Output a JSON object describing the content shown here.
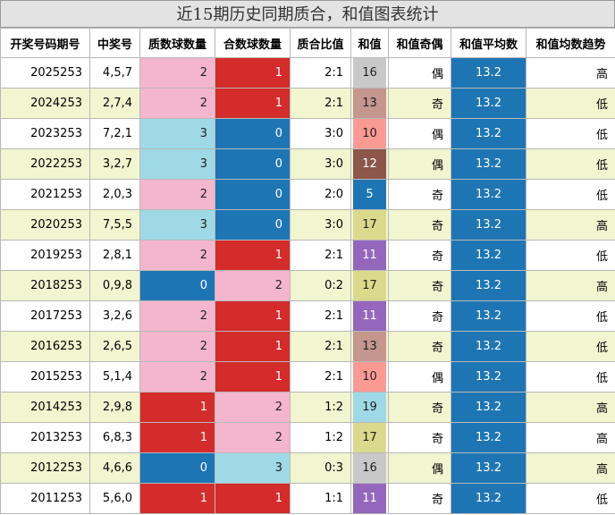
{
  "title": "近15期历史同期质合，和值图表统计",
  "headers": [
    "开奖号码期号",
    "中奖号",
    "质数球数量",
    "合数球数量",
    "质合比值",
    "和值",
    "和值奇偶",
    "和值平均数",
    "和值均数趋势"
  ],
  "colors": {
    "pink": "#f4b6cc",
    "red": "#d42b2b",
    "blue": "#1e75b4",
    "cyan": "#9fd9e6",
    "sum_gray": "#c8c8c8",
    "sum_rose": "#c4968e",
    "sum_salmon": "#fb9a92",
    "sum_brown": "#8c564b",
    "sum_blue": "#1e75b4",
    "sum_olive": "#dada8c",
    "sum_purple": "#9467bd",
    "sum_lightblue": "#9fd9e6",
    "row_alt": "#f1f5d0"
  },
  "rows": [
    {
      "issue": "2025253",
      "nums": "4,5,7",
      "prime": "2",
      "prime_c": "pink",
      "comp": "1",
      "comp_c": "red",
      "ratio": "2:1",
      "sum": "16",
      "sum_c": "sum_gray",
      "parity": "偶",
      "avg": "13.2",
      "trend": "高"
    },
    {
      "issue": "2024253",
      "nums": "2,7,4",
      "prime": "2",
      "prime_c": "pink",
      "comp": "1",
      "comp_c": "red",
      "ratio": "2:1",
      "sum": "13",
      "sum_c": "sum_rose",
      "parity": "奇",
      "avg": "13.2",
      "trend": "低"
    },
    {
      "issue": "2023253",
      "nums": "7,2,1",
      "prime": "3",
      "prime_c": "cyan",
      "comp": "0",
      "comp_c": "blue",
      "ratio": "3:0",
      "sum": "10",
      "sum_c": "sum_salmon",
      "parity": "偶",
      "avg": "13.2",
      "trend": "低"
    },
    {
      "issue": "2022253",
      "nums": "3,2,7",
      "prime": "3",
      "prime_c": "cyan",
      "comp": "0",
      "comp_c": "blue",
      "ratio": "3:0",
      "sum": "12",
      "sum_c": "sum_brown",
      "parity": "偶",
      "avg": "13.2",
      "trend": "低"
    },
    {
      "issue": "2021253",
      "nums": "2,0,3",
      "prime": "2",
      "prime_c": "pink",
      "comp": "0",
      "comp_c": "blue",
      "ratio": "2:0",
      "sum": "5",
      "sum_c": "sum_blue",
      "parity": "奇",
      "avg": "13.2",
      "trend": "低"
    },
    {
      "issue": "2020253",
      "nums": "7,5,5",
      "prime": "3",
      "prime_c": "cyan",
      "comp": "0",
      "comp_c": "blue",
      "ratio": "3:0",
      "sum": "17",
      "sum_c": "sum_olive",
      "parity": "奇",
      "avg": "13.2",
      "trend": "高"
    },
    {
      "issue": "2019253",
      "nums": "2,8,1",
      "prime": "2",
      "prime_c": "pink",
      "comp": "1",
      "comp_c": "red",
      "ratio": "2:1",
      "sum": "11",
      "sum_c": "sum_purple",
      "parity": "奇",
      "avg": "13.2",
      "trend": "低"
    },
    {
      "issue": "2018253",
      "nums": "0,9,8",
      "prime": "0",
      "prime_c": "blue",
      "comp": "2",
      "comp_c": "pink",
      "ratio": "0:2",
      "sum": "17",
      "sum_c": "sum_olive",
      "parity": "奇",
      "avg": "13.2",
      "trend": "高"
    },
    {
      "issue": "2017253",
      "nums": "3,2,6",
      "prime": "2",
      "prime_c": "pink",
      "comp": "1",
      "comp_c": "red",
      "ratio": "2:1",
      "sum": "11",
      "sum_c": "sum_purple",
      "parity": "奇",
      "avg": "13.2",
      "trend": "低"
    },
    {
      "issue": "2016253",
      "nums": "2,6,5",
      "prime": "2",
      "prime_c": "pink",
      "comp": "1",
      "comp_c": "red",
      "ratio": "2:1",
      "sum": "13",
      "sum_c": "sum_rose",
      "parity": "奇",
      "avg": "13.2",
      "trend": "低"
    },
    {
      "issue": "2015253",
      "nums": "5,1,4",
      "prime": "2",
      "prime_c": "pink",
      "comp": "1",
      "comp_c": "red",
      "ratio": "2:1",
      "sum": "10",
      "sum_c": "sum_salmon",
      "parity": "偶",
      "avg": "13.2",
      "trend": "低"
    },
    {
      "issue": "2014253",
      "nums": "2,9,8",
      "prime": "1",
      "prime_c": "red",
      "comp": "2",
      "comp_c": "pink",
      "ratio": "1:2",
      "sum": "19",
      "sum_c": "sum_lightblue",
      "parity": "奇",
      "avg": "13.2",
      "trend": "高"
    },
    {
      "issue": "2013253",
      "nums": "6,8,3",
      "prime": "1",
      "prime_c": "red",
      "comp": "2",
      "comp_c": "pink",
      "ratio": "1:2",
      "sum": "17",
      "sum_c": "sum_olive",
      "parity": "奇",
      "avg": "13.2",
      "trend": "高"
    },
    {
      "issue": "2012253",
      "nums": "4,6,6",
      "prime": "0",
      "prime_c": "blue",
      "comp": "3",
      "comp_c": "cyan",
      "ratio": "0:3",
      "sum": "16",
      "sum_c": "sum_gray",
      "parity": "偶",
      "avg": "13.2",
      "trend": "高"
    },
    {
      "issue": "2011253",
      "nums": "5,6,0",
      "prime": "1",
      "prime_c": "red",
      "comp": "1",
      "comp_c": "red",
      "ratio": "1:1",
      "sum": "11",
      "sum_c": "sum_purple",
      "parity": "奇",
      "avg": "13.2",
      "trend": "低"
    }
  ]
}
